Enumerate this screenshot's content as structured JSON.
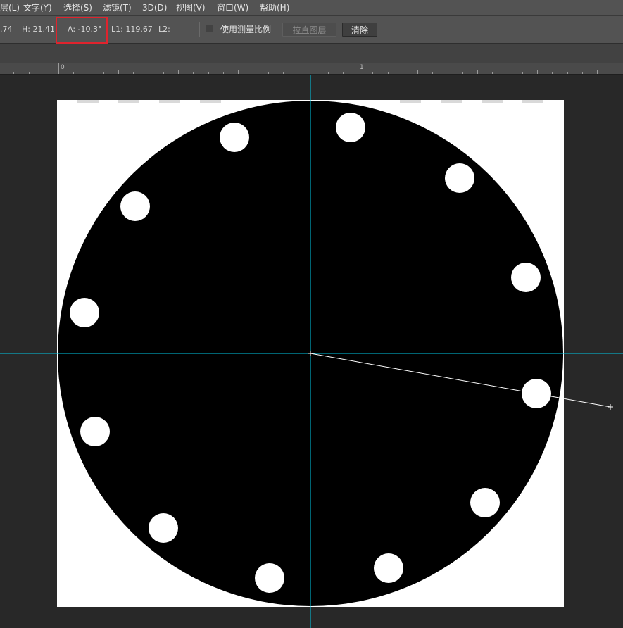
{
  "menu": [
    {
      "label": "层(L)"
    },
    {
      "label": "文字(Y)"
    },
    {
      "label": "选择(S)"
    },
    {
      "label": "滤镜(T)"
    },
    {
      "label": "3D(D)"
    },
    {
      "label": "视图(V)"
    },
    {
      "label": "窗口(W)"
    },
    {
      "label": "帮助(H)"
    }
  ],
  "options": {
    "w_value": ".74",
    "h_value": "H: 21.41",
    "angle_value": "A: -10.3°",
    "l1_value": "L1: 119.67",
    "l2_value": "L2:",
    "scale_label": "使用测量比例",
    "straighten_label": "拉直图层",
    "clear_label": "清除"
  },
  "ruler": {
    "labels": [
      "0",
      "1"
    ]
  },
  "colors": {
    "chrome": "#535353",
    "workspace": "#282828",
    "guide": "#00c8e6",
    "highlight": "#e0232d"
  }
}
